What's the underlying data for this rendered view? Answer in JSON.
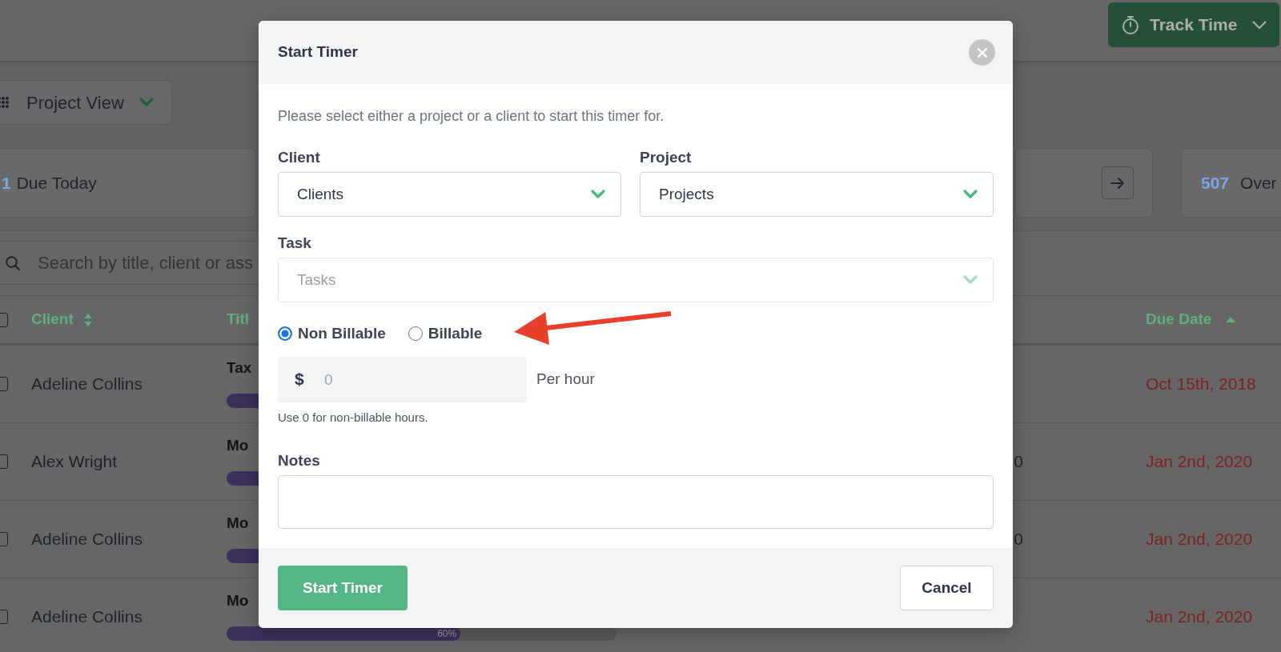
{
  "top_bar": {
    "track_time_button": {
      "label": "Track Time"
    }
  },
  "view_dropdown": {
    "value": "Project View"
  },
  "stat_cards": [
    {
      "count": "1",
      "label": "Due Today",
      "arrow_button": false
    },
    {
      "arrow_button": true
    },
    {
      "count": "507",
      "label": "Over",
      "arrow_button": false
    }
  ],
  "search": {
    "placeholder": "Search by title, client or ass"
  },
  "table": {
    "select_all": {
      "checked": false
    },
    "columns": [
      {
        "label": "Client",
        "sortable": true,
        "sorted_ascending": false
      },
      {
        "label": "Titl"
      },
      {
        "label": "Due Date",
        "sortable": true,
        "sorted_ascending": true
      }
    ],
    "rows": [
      {
        "checked": false,
        "client": "Adeline Collins",
        "title": "Tax",
        "progress": {
          "kind": "stub"
        },
        "due_date": "Oct 15th, 2018",
        "overdue": true
      },
      {
        "checked": false,
        "client": "Alex Wright",
        "title": "Mo",
        "progress": {
          "kind": "stub"
        },
        "column_4": "0",
        "due_date": "Jan 2nd, 2020",
        "overdue": true
      },
      {
        "checked": false,
        "client": "Adeline Collins",
        "title": "Mo",
        "progress": {
          "kind": "stub"
        },
        "column_4": "0",
        "due_date": "Jan 2nd, 2020",
        "overdue": true
      },
      {
        "checked": false,
        "client": "Adeline Collins",
        "title": "Mo",
        "progress": {
          "kind": "bar",
          "level": 0.6,
          "label": "60%"
        },
        "due_date": "Jan 2nd, 2020",
        "overdue": true
      }
    ]
  },
  "dialog": {
    "title": "Start Timer",
    "intro": "Please select either a project or a client to start this timer for.",
    "selects": [
      {
        "label": "Client",
        "value": "Clients",
        "disabled": false
      },
      {
        "label": "Project",
        "value": "Projects",
        "disabled": false
      },
      {
        "label": "Task",
        "placeholder": "Tasks",
        "disabled": true
      }
    ],
    "billing": [
      {
        "label": "Non Billable",
        "selected": true
      },
      {
        "label": "Billable",
        "selected": false
      }
    ],
    "rate": {
      "currency": "$",
      "placeholder": "0",
      "unit": "Per hour",
      "help": "Use 0 for non-billable hours."
    },
    "notes": {
      "label": "Notes"
    },
    "buttons": [
      {
        "label": "Start Timer",
        "kind": "primary"
      },
      {
        "label": "Cancel",
        "kind": "secondary"
      }
    ]
  }
}
